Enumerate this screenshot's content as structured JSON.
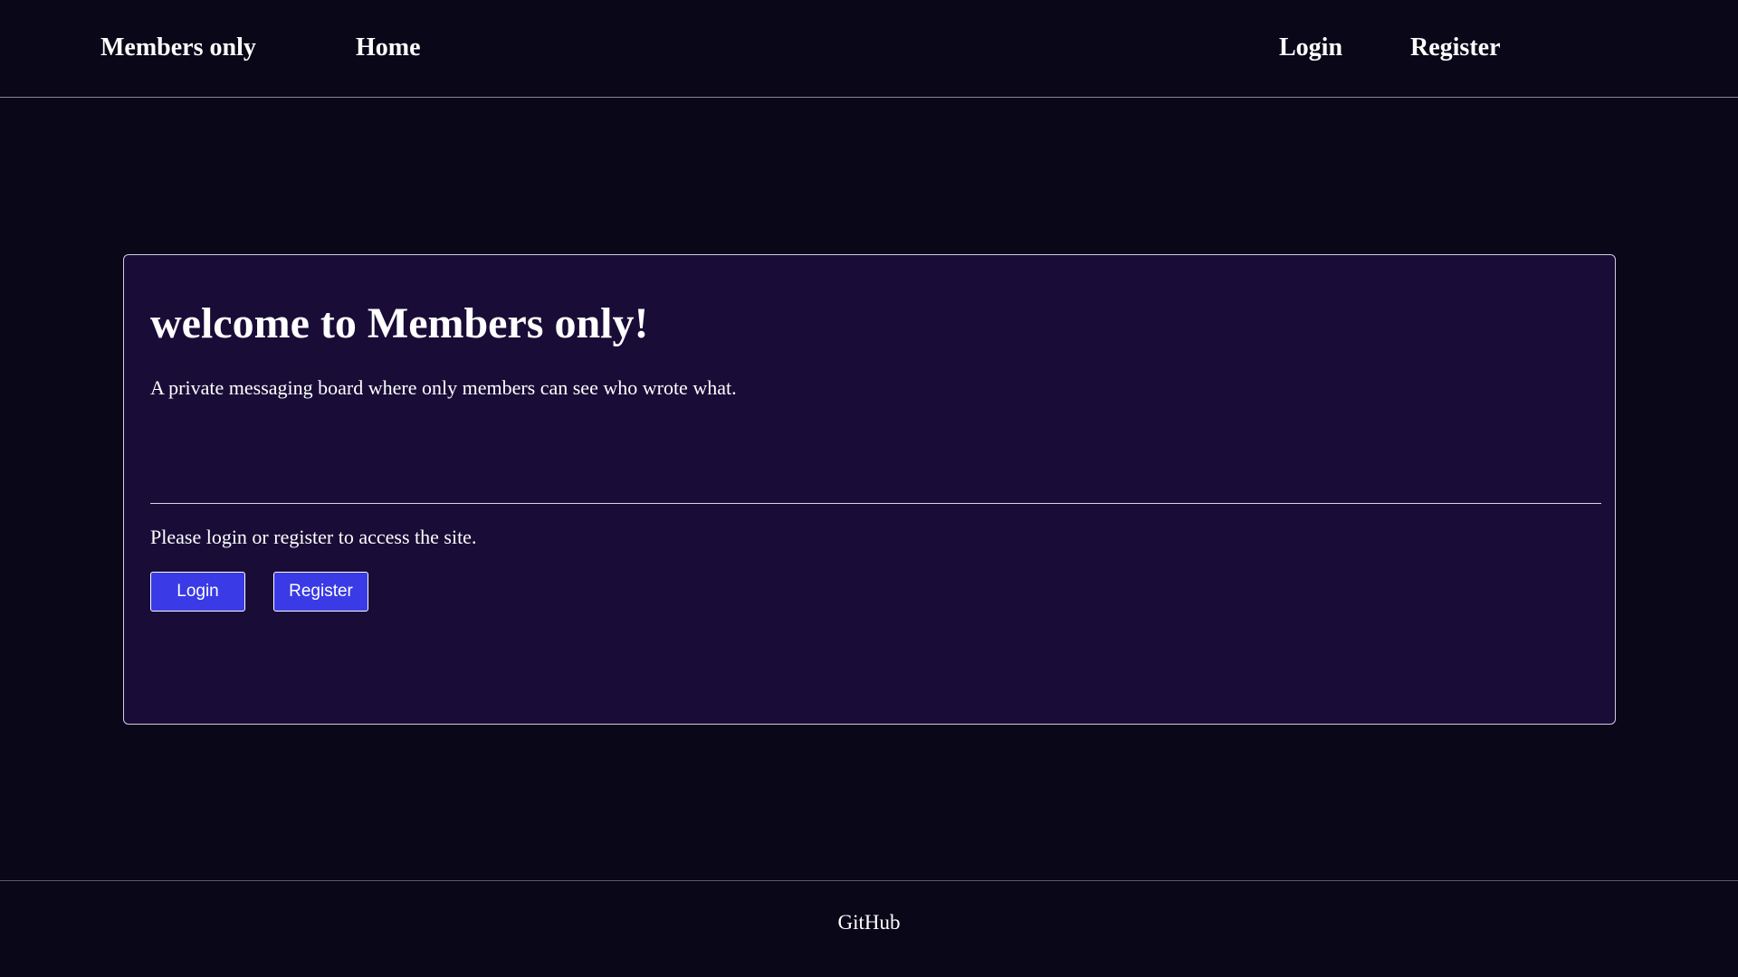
{
  "nav": {
    "brand": "Members only",
    "home": "Home",
    "login": "Login",
    "register": "Register"
  },
  "card": {
    "title": "welcome to Members only!",
    "tagline": "A private messaging board where only members can see who wrote what.",
    "prompt": "Please login or register to access the site.",
    "login_button": "Login",
    "register_button": "Register"
  },
  "footer": {
    "link": "GitHub"
  },
  "colors": {
    "background": "#0a0719",
    "card_background": "#190d37",
    "button": "#3a3ae6",
    "text": "#ffffff"
  }
}
